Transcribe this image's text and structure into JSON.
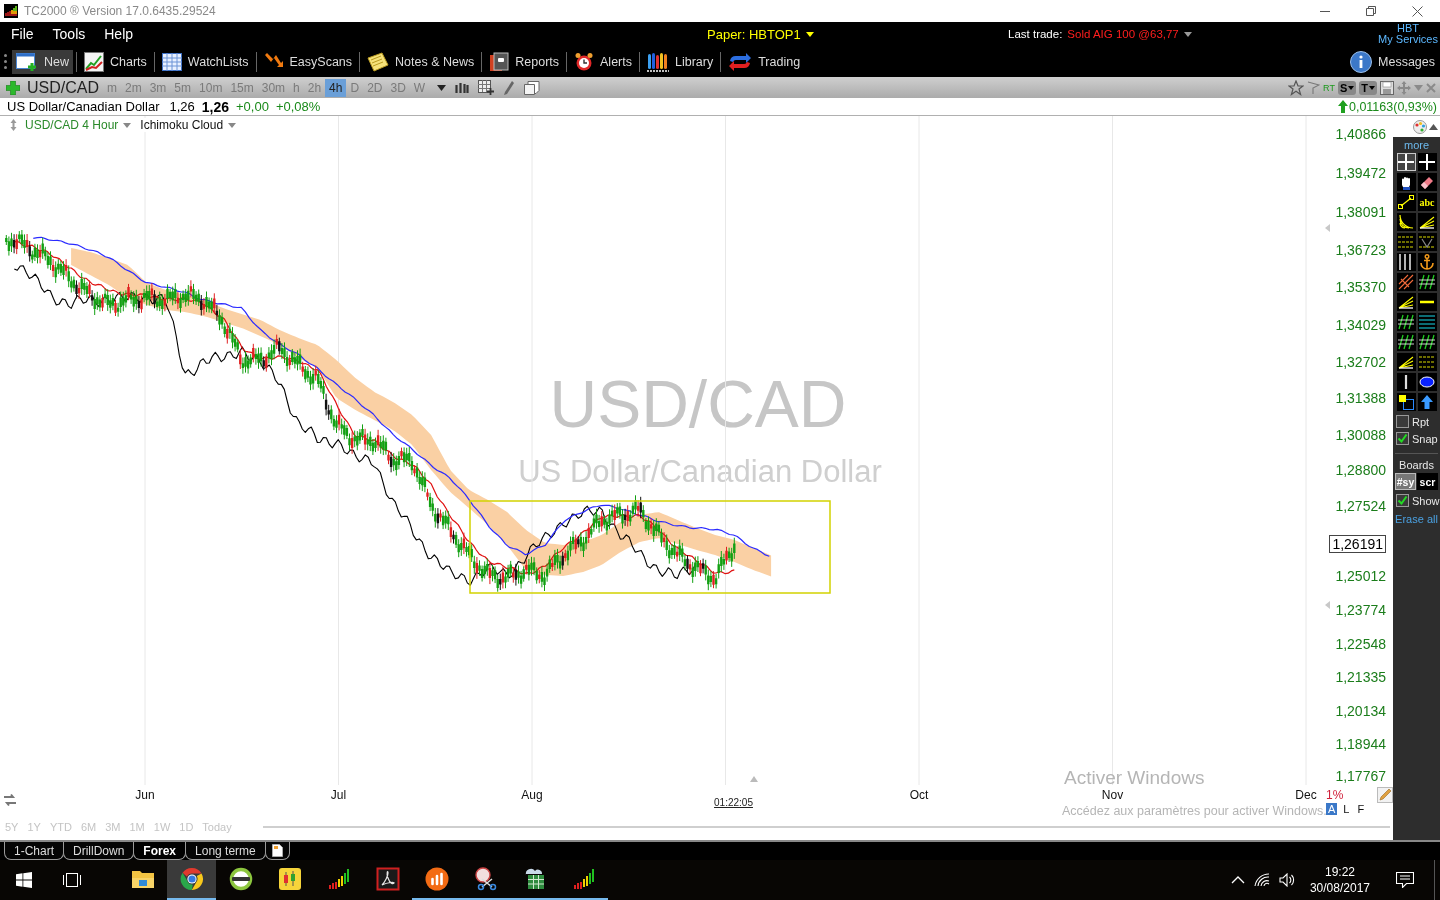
{
  "title_bar": {
    "title": "TC2000 ® Version 17.0.6435.29524"
  },
  "menu_bar": {
    "items": [
      "File",
      "Tools",
      "Help"
    ],
    "account": "Paper: HBTOP1",
    "last_trade_label": "Last trade:",
    "last_trade": "Sold AIG 100 @63,77",
    "services": [
      "HBT",
      "My Services"
    ]
  },
  "toolbar": {
    "buttons": [
      {
        "kind": "new",
        "label": "New",
        "selected": true
      },
      {
        "kind": "charts",
        "label": "Charts",
        "selected": false
      },
      {
        "kind": "watchlists",
        "label": "WatchLists",
        "selected": false
      },
      {
        "kind": "easyscans",
        "label": "EasyScans",
        "selected": false
      },
      {
        "kind": "notes",
        "label": "Notes & News",
        "selected": false
      },
      {
        "kind": "reports",
        "label": "Reports",
        "selected": false
      },
      {
        "kind": "alerts",
        "label": "Alerts",
        "selected": false
      },
      {
        "kind": "library",
        "label": "Library",
        "selected": false
      },
      {
        "kind": "trading",
        "label": "Trading",
        "selected": false
      }
    ],
    "messages": "Messages"
  },
  "chart_header": {
    "symbol": "USD/CAD",
    "intervals": [
      {
        "label": "m",
        "selected": false
      },
      {
        "label": "2m",
        "selected": false
      },
      {
        "label": "3m",
        "selected": false
      },
      {
        "label": "5m",
        "selected": false
      },
      {
        "label": "10m",
        "selected": false
      },
      {
        "label": "15m",
        "selected": false
      },
      {
        "label": "30m",
        "selected": false
      },
      {
        "label": "h",
        "selected": false
      },
      {
        "label": "2h",
        "selected": false
      },
      {
        "label": "4h",
        "selected": true
      },
      {
        "label": "D",
        "selected": false
      },
      {
        "label": "2D",
        "selected": false
      },
      {
        "label": "3D",
        "selected": false
      },
      {
        "label": "W",
        "selected": false
      }
    ],
    "rt_label": "RT",
    "style_buttons": [
      "S",
      "T"
    ]
  },
  "quote": {
    "name": "US Dollar/Canadian Dollar",
    "bid": "1,26",
    "last": "1,26",
    "change": "+0,00",
    "change_percent": "+0,08%",
    "range_change": "0,01163(0,93%)"
  },
  "chart": {
    "title": "USD/CAD 4 Hour",
    "indicator": "Ichimoku Cloud",
    "background_symbol": "USD/CAD",
    "background_name": "US Dollar/Canadian Dollar",
    "y_axis": [
      {
        "kind": "tick",
        "label": "1,40866"
      },
      {
        "kind": "tick",
        "label": "1,39472"
      },
      {
        "kind": "tick",
        "label": "1,38091"
      },
      {
        "kind": "tick",
        "label": "1,36723"
      },
      {
        "kind": "tick",
        "label": "1,35370"
      },
      {
        "kind": "tick",
        "label": "1,34029"
      },
      {
        "kind": "tick",
        "label": "1,32702"
      },
      {
        "kind": "tick",
        "label": "1,31388"
      },
      {
        "kind": "tick",
        "label": "1,30088"
      },
      {
        "kind": "tick",
        "label": "1,28800"
      },
      {
        "kind": "tick",
        "label": "1,27524"
      },
      {
        "kind": "price",
        "label": "1,26191"
      },
      {
        "kind": "tick",
        "label": "1,25012"
      },
      {
        "kind": "tick",
        "label": "1,23774"
      },
      {
        "kind": "tick",
        "label": "1,22548"
      },
      {
        "kind": "tick",
        "label": "1,21335"
      },
      {
        "kind": "tick",
        "label": "1,20134"
      },
      {
        "kind": "tick",
        "label": "1,18944"
      },
      {
        "kind": "tick",
        "label": "1,17767"
      }
    ],
    "x_axis": [
      {
        "kind": "month",
        "label": "Jun"
      },
      {
        "kind": "month",
        "label": "Jul"
      },
      {
        "kind": "month",
        "label": "Aug"
      },
      {
        "kind": "timer",
        "label": "01:22:05"
      },
      {
        "kind": "month",
        "label": "Oct"
      },
      {
        "kind": "month",
        "label": "Nov"
      },
      {
        "kind": "month",
        "label": "Dec"
      }
    ],
    "scale_percent": "1%",
    "scale_modes": [
      {
        "label": "A",
        "selected": true
      },
      {
        "label": "L",
        "selected": false
      },
      {
        "label": "F",
        "selected": false
      }
    ],
    "range_buttons": [
      "5Y",
      "1Y",
      "YTD",
      "6M",
      "3M",
      "1M",
      "1W",
      "1D",
      "Today"
    ]
  },
  "drawing_panel": {
    "more": "more",
    "tools": [
      {
        "kind": "crosshair",
        "selected": true
      },
      {
        "kind": "crosshair",
        "selected": false
      },
      {
        "kind": "hand",
        "selected": false
      },
      {
        "kind": "eraser",
        "selected": false
      },
      {
        "kind": "segment",
        "selected": false
      },
      {
        "kind": "text",
        "label": "abc",
        "selected": false
      },
      {
        "kind": "arcs",
        "selected": false
      },
      {
        "kind": "fan",
        "selected": false
      },
      {
        "kind": "hlines",
        "selected": false
      },
      {
        "kind": "vchannel",
        "selected": false
      },
      {
        "kind": "vlines",
        "selected": false
      },
      {
        "kind": "anchor",
        "selected": false
      },
      {
        "kind": "pitchfork",
        "selected": false
      },
      {
        "kind": "channel",
        "selected": false
      },
      {
        "kind": "fan",
        "selected": false
      },
      {
        "kind": "hline",
        "selected": false
      },
      {
        "kind": "channel",
        "selected": false
      },
      {
        "kind": "levels",
        "selected": false
      },
      {
        "kind": "channel",
        "selected": false
      },
      {
        "kind": "channel",
        "selected": false
      },
      {
        "kind": "fan",
        "selected": false
      },
      {
        "kind": "hlines",
        "selected": false
      },
      {
        "kind": "bar",
        "selected": false
      },
      {
        "kind": "ellipse",
        "selected": false
      },
      {
        "kind": "boxes",
        "selected": false
      },
      {
        "kind": "arrow",
        "selected": false
      }
    ],
    "options": [
      {
        "label": "Rpt",
        "checked": false
      },
      {
        "label": "Snap",
        "checked": true
      }
    ],
    "boards_label": "Boards",
    "boards": [
      {
        "label": "#sy",
        "selected": true
      },
      {
        "label": "scr",
        "selected": false
      }
    ],
    "show": {
      "label": "Show",
      "checked": true
    },
    "erase_all": "Erase all"
  },
  "os_notice": {
    "title": "Activer Windows",
    "text": "Accédez aux paramètres pour activer Windows."
  },
  "layout_tabs": [
    {
      "label": "1-Chart",
      "selected": false
    },
    {
      "label": "DrillDown",
      "selected": false
    },
    {
      "label": "Forex",
      "selected": true
    },
    {
      "label": "Long terme",
      "selected": false
    }
  ],
  "taskbar": {
    "apps": [
      {
        "kind": "folder",
        "active": false,
        "running": false
      },
      {
        "kind": "roundlogo",
        "active": true,
        "running": true
      },
      {
        "kind": "ring",
        "active": false,
        "running": false
      },
      {
        "kind": "candles",
        "active": false,
        "running": false
      },
      {
        "kind": "bars",
        "active": false,
        "running": false
      },
      {
        "kind": "pdf",
        "active": false,
        "running": false
      },
      {
        "kind": "orangebars",
        "active": false,
        "running": true
      },
      {
        "kind": "scissors",
        "active": false,
        "running": true
      },
      {
        "kind": "spreadsheet",
        "active": false,
        "running": true
      },
      {
        "kind": "bars",
        "active": false,
        "running": true
      }
    ],
    "time": "19:22",
    "date": "30/08/2017"
  }
}
